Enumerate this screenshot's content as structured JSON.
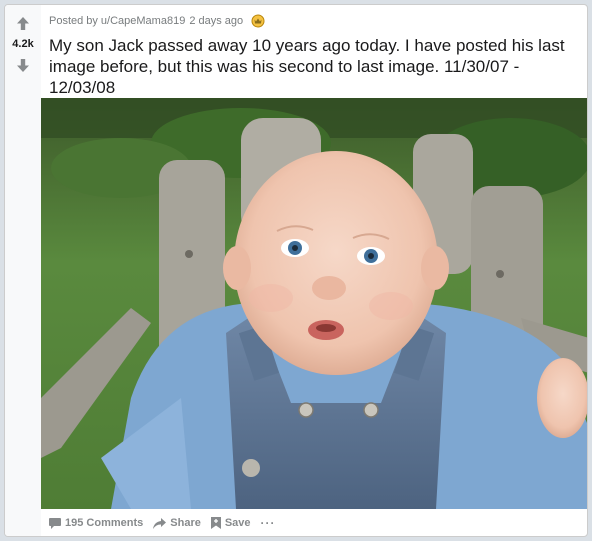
{
  "vote": {
    "count": "4.2k",
    "upvote_icon": "arrow-up-icon",
    "downvote_icon": "arrow-down-icon"
  },
  "meta": {
    "posted_by": "Posted by",
    "author": "u/CapeMama819",
    "time": "2 days ago",
    "award_icon": "award-medal-icon"
  },
  "post": {
    "title": "My son Jack passed away 10 years ago today. I have posted his last image before, but this was his second to last image. 11/30/07 - 12/03/08"
  },
  "actions": {
    "comments_label": "195 Comments",
    "share_label": "Share",
    "save_label": "Save",
    "more_label": "···"
  },
  "colors": {
    "accent_gray": "#878a8c",
    "award_gold": "#d4a017",
    "text": "#1a1a1b"
  }
}
